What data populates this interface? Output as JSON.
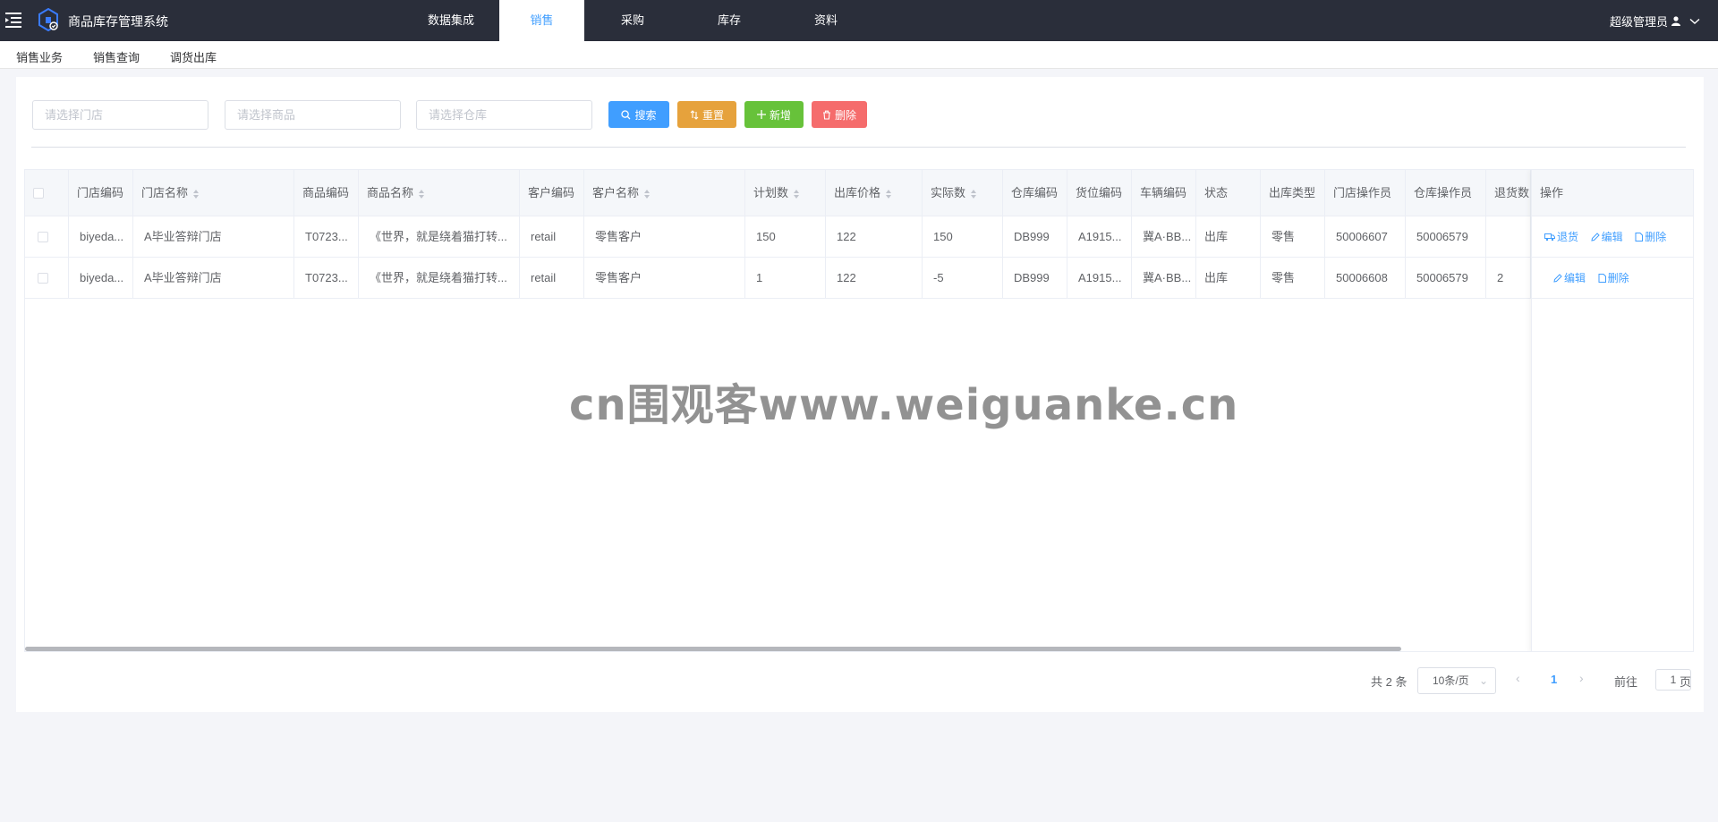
{
  "app": {
    "title": "商品库存管理系统",
    "user": "超级管理员"
  },
  "nav": [
    {
      "label": "数据集成",
      "active": false
    },
    {
      "label": "销售",
      "active": true
    },
    {
      "label": "采购",
      "active": false
    },
    {
      "label": "库存",
      "active": false
    },
    {
      "label": "资料",
      "active": false
    }
  ],
  "subnav": [
    "销售业务",
    "销售查询",
    "调货出库"
  ],
  "search": {
    "store_placeholder": "请选择门店",
    "product_placeholder": "请选择商品",
    "warehouse_placeholder": "请选择仓库"
  },
  "buttons": {
    "search": "搜索",
    "reset": "重置",
    "add": "新增",
    "delete": "删除"
  },
  "table": {
    "columns": [
      "门店编码",
      "门店名称",
      "商品编码",
      "商品名称",
      "客户编码",
      "客户名称",
      "计划数",
      "出库价格",
      "实际数",
      "仓库编码",
      "货位编码",
      "车辆编码",
      "状态",
      "出库类型",
      "门店操作员",
      "仓库操作员",
      "退货数",
      "操作"
    ],
    "rows": [
      {
        "cells": [
          "biyeda...",
          "A毕业答辩门店",
          "T0723...",
          "《世界，就是绕着猫打转...",
          "retail",
          "零售客户",
          "150",
          "122",
          "150",
          "DB999",
          "A1915...",
          "冀A·BB...",
          "出库",
          "零售",
          "50006607",
          "50006579",
          ""
        ],
        "actions": [
          "退货",
          "编辑",
          "删除"
        ]
      },
      {
        "cells": [
          "biyeda...",
          "A毕业答辩门店",
          "T0723...",
          "《世界，就是绕着猫打转...",
          "retail",
          "零售客户",
          "1",
          "122",
          "-5",
          "DB999",
          "A1915...",
          "冀A·BB...",
          "出库",
          "零售",
          "50006608",
          "50006579",
          "2"
        ],
        "actions": [
          "编辑",
          "删除"
        ]
      }
    ]
  },
  "pagination": {
    "total": "共 2 条",
    "page_size": "10条/页",
    "current": "1",
    "goto_label": "前往",
    "goto_value": "1",
    "page_suffix": "页"
  },
  "watermark": "cn围观客www.weiguanke.cn",
  "colors": {
    "topbar": "#2a2e3a",
    "primary": "#409eff",
    "warning": "#e6a23c",
    "success": "#67c23a",
    "danger": "#f56c6c"
  }
}
